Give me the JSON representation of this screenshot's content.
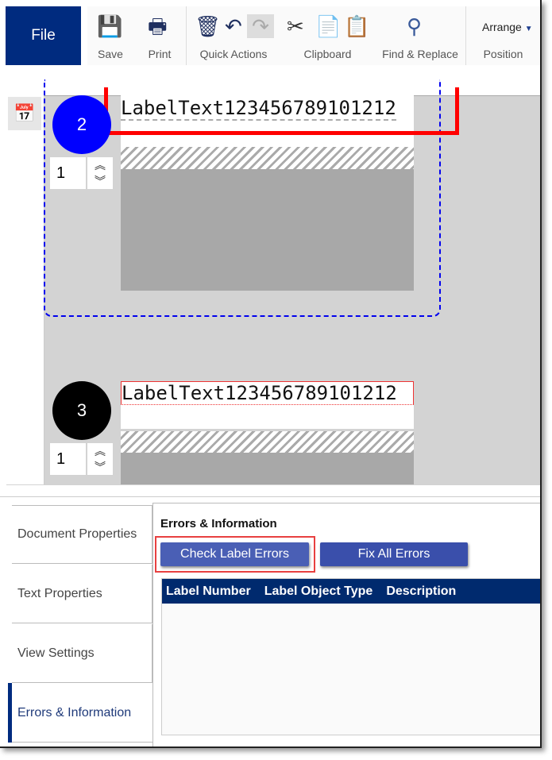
{
  "toolbar": {
    "file": "File",
    "save": "Save",
    "print": "Print",
    "quick_actions": "Quick Actions",
    "clipboard": "Clipboard",
    "find_replace": "Find & Replace",
    "arrange": "Arrange",
    "position": "Position"
  },
  "labels": [
    {
      "number": "2",
      "text": "LabelText123456789101212",
      "quantity": "1",
      "color": "#0000ff"
    },
    {
      "number": "3",
      "text": "LabelText123456789101212",
      "quantity": "1",
      "color": "#000000"
    }
  ],
  "tabs": [
    "Document Properties",
    "Text Properties",
    "View Settings",
    "Errors & Information"
  ],
  "active_tab": "Errors & Information",
  "panel": {
    "title": "Errors & Information",
    "check_button": "Check Label Errors",
    "fix_button": "Fix All Errors",
    "columns": [
      "Label Number",
      "Label Object Type",
      "Description"
    ],
    "rows": []
  },
  "colors": {
    "brand": "#002b7f",
    "button": "#3f51a8",
    "highlight": "#ff0000"
  }
}
